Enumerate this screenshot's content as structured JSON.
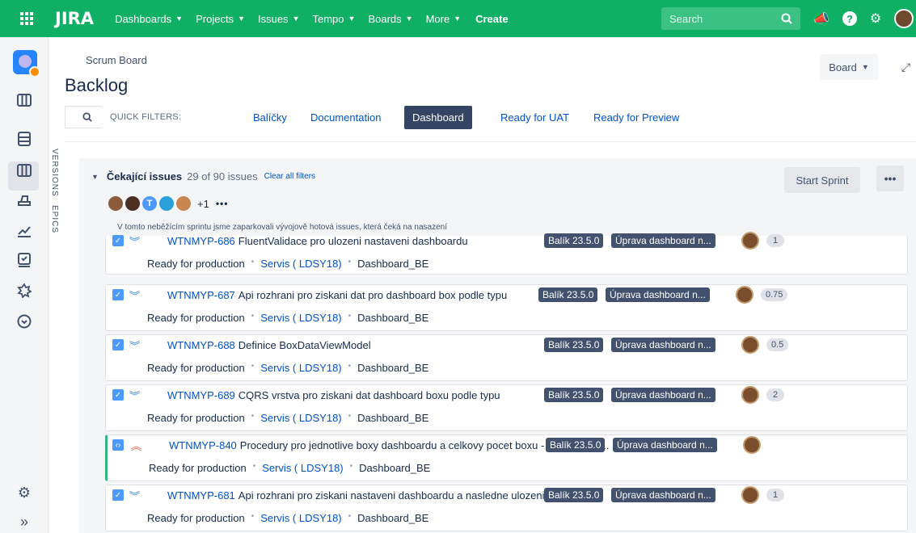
{
  "topbar": {
    "logo": "JIRA",
    "nav": [
      {
        "label": "Dashboards"
      },
      {
        "label": "Projects"
      },
      {
        "label": "Issues"
      },
      {
        "label": "Tempo"
      },
      {
        "label": "Boards"
      },
      {
        "label": "More"
      }
    ],
    "create": "Create",
    "search_placeholder": "Search"
  },
  "sidebar": {
    "vertical_tabs": [
      "VERSIONS",
      "EPICS"
    ],
    "icons": [
      "project-avatar",
      "board-icon",
      "backlog-icon",
      "columns-icon",
      "releases-icon",
      "reports-icon",
      "tasks-icon",
      "components-icon",
      "timer-icon",
      "settings-icon",
      "expand-icon"
    ]
  },
  "page": {
    "breadcrumb": "Scrum Board",
    "title": "Backlog",
    "board_button": "Board"
  },
  "filters": {
    "label": "QUICK FILTERS:",
    "items": [
      {
        "label": "Balíčky",
        "active": false
      },
      {
        "label": "Documentation",
        "active": false
      },
      {
        "label": "Dashboard",
        "active": true
      },
      {
        "label": "Ready for UAT",
        "active": false
      },
      {
        "label": "Ready for Preview",
        "active": false
      }
    ]
  },
  "section": {
    "name": "Čekající issues",
    "count": "29 of 90 issues",
    "clear": "Clear all filters",
    "start_sprint": "Start Sprint",
    "more": "•••",
    "assignees_extra": "+1",
    "assignees_more": "•••",
    "avatar_letter": "T",
    "description": "V tomto neběžícím sprintu jsme zaparkovali vývojově hotová issues, která čeká na nasazení"
  },
  "issues": [
    {
      "key": "WTNMYP-686",
      "summary": "FluentValidace pro ulozeni nastaveni dashboardu",
      "status": "Ready for production",
      "component": "Servis (  LDSY18)",
      "label": "Dashboard_BE",
      "version": "Balík 23.5.0",
      "epic": "Úprava dashboard n...",
      "estimate": "1",
      "type": "story",
      "priority": "lowest"
    },
    {
      "key": "WTNMYP-687",
      "summary": "Api rozhrani pro ziskani dat pro dashboard box podle typu",
      "status": "Ready for production",
      "component": "Servis (  LDSY18)",
      "label": "Dashboard_BE",
      "version": "Balík 23.5.0",
      "epic": "Úprava dashboard n...",
      "estimate": "0.75",
      "type": "story",
      "priority": "lowest"
    },
    {
      "key": "WTNMYP-688",
      "summary": "Definice BoxDataViewModel",
      "status": "Ready for production",
      "component": "Servis (  LDSY18)",
      "label": "Dashboard_BE",
      "version": "Balík 23.5.0",
      "epic": "Úprava dashboard n...",
      "estimate": "0.5",
      "type": "story",
      "priority": "lowest"
    },
    {
      "key": "WTNMYP-689",
      "summary": "CQRS vrstva pro ziskani dat dashboard boxu podle typu",
      "status": "Ready for production",
      "component": "Servis (  LDSY18)",
      "label": "Dashboard_BE",
      "version": "Balík 23.5.0",
      "epic": "Úprava dashboard n...",
      "estimate": "2",
      "type": "story",
      "priority": "lowest"
    },
    {
      "key": "WTNMYP-840",
      "summary": "Procedury pro jednotlive boxy dashboardu a celkovy pocet boxu - zrušení OR...",
      "status": "Ready for production",
      "component": "Servis (  LDSY18)",
      "label": "Dashboard_BE",
      "version": "Balík 23.5.0",
      "epic": "Úprava dashboard n...",
      "estimate": "",
      "type": "subtask",
      "priority": "highest"
    },
    {
      "key": "WTNMYP-681",
      "summary": "Api rozhrani pro ziskani nastaveni dashboardu a nasledne ulozeni",
      "status": "Ready for production",
      "component": "Servis (  LDSY18)",
      "label": "Dashboard_BE",
      "version": "Balík 23.5.0",
      "epic": "Úprava dashboard n...",
      "estimate": "1",
      "type": "story",
      "priority": "lowest"
    }
  ],
  "colors": {
    "topbar": "#10b064",
    "link": "#0052cc",
    "lozenge": "#42526e",
    "priority_low": "#2684ff",
    "priority_high": "#ff5630"
  }
}
